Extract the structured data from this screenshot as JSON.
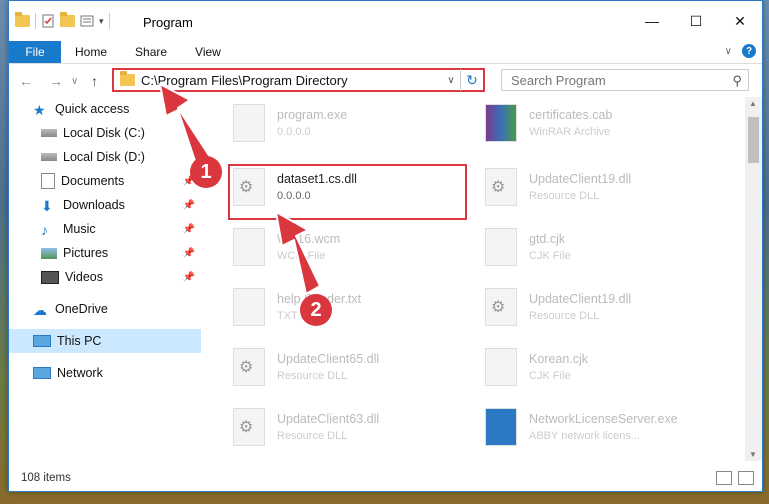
{
  "window": {
    "title": "Program",
    "controls": {
      "minimize": "—",
      "maximize": "☐",
      "close": "✕"
    }
  },
  "ribbon": {
    "file_tab": "File",
    "tabs": [
      "Home",
      "Share",
      "View"
    ],
    "help": "?"
  },
  "navigation": {
    "back": "←",
    "forward": "→",
    "recent": "∨",
    "up": "↑"
  },
  "address_bar": {
    "path": "C:\\Program Files\\Program Directory",
    "refresh": "↻"
  },
  "search": {
    "placeholder": "Search Program"
  },
  "sidebar": {
    "items": [
      {
        "label": "Quick access",
        "icon": "star-icon"
      },
      {
        "label": "Local Disk (C:)",
        "icon": "drive-icon"
      },
      {
        "label": "Local Disk (D:)",
        "icon": "drive-icon"
      },
      {
        "label": "Documents",
        "icon": "documents-icon",
        "pinned": true
      },
      {
        "label": "Downloads",
        "icon": "download-icon",
        "pinned": true
      },
      {
        "label": "Music",
        "icon": "music-icon",
        "pinned": true
      },
      {
        "label": "Pictures",
        "icon": "pictures-icon",
        "pinned": true
      },
      {
        "label": "Videos",
        "icon": "videos-icon",
        "pinned": true
      },
      {
        "label": "OneDrive",
        "icon": "cloud-icon"
      },
      {
        "label": "This PC",
        "icon": "computer-icon",
        "selected": true
      },
      {
        "label": "Network",
        "icon": "network-icon"
      }
    ]
  },
  "files": [
    {
      "name": "program.exe",
      "sub": "0.0.0.0"
    },
    {
      "name": "certificates.cab",
      "sub": "WinRAR Archive"
    },
    {
      "name": "dataset1.cs.dll",
      "sub": "0.0.0.0",
      "highlighted": true
    },
    {
      "name": "UpdateClient19.dll",
      "sub": "Resource DLL"
    },
    {
      "name": "WP16.wcm",
      "sub": "WCM File"
    },
    {
      "name": "gtd.cjk",
      "sub": "CJK File"
    },
    {
      "name": "help Reader.txt",
      "sub": "TXT File"
    },
    {
      "name": "UpdateClient19.dll",
      "sub": "Resource DLL"
    },
    {
      "name": "UpdateClient65.dll",
      "sub": "Resource DLL"
    },
    {
      "name": "Korean.cjk",
      "sub": "CJK File"
    },
    {
      "name": "UpdateClient63.dll",
      "sub": "Resource DLL"
    },
    {
      "name": "NetworkLicenseServer.exe",
      "sub": "ABBY network licens..."
    }
  ],
  "status_bar": {
    "item_count": "108 items"
  },
  "callouts": [
    "1",
    "2"
  ],
  "colors": {
    "accent": "#1979ca",
    "highlight": "#d9363e",
    "selection": "#cce8ff"
  }
}
